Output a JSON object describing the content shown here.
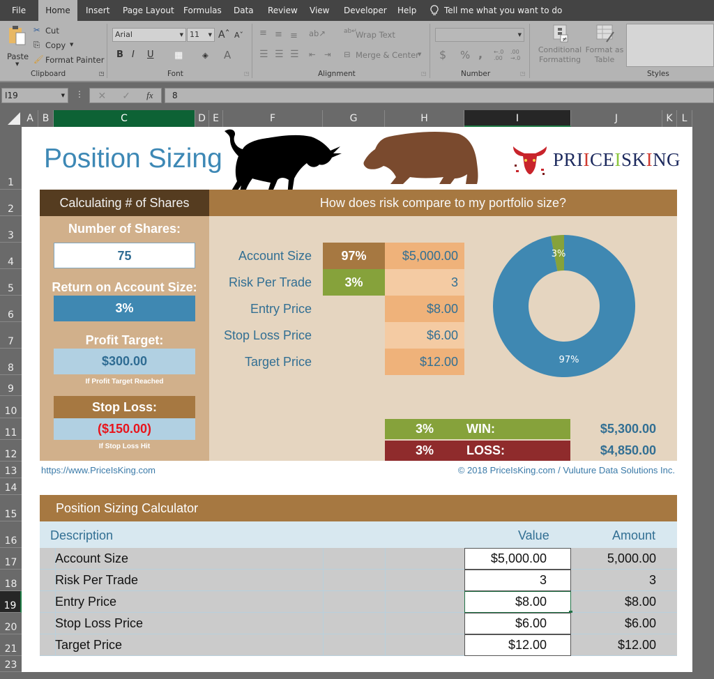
{
  "menu": {
    "tabs": [
      "File",
      "Home",
      "Insert",
      "Page Layout",
      "Formulas",
      "Data",
      "Review",
      "View",
      "Developer",
      "Help"
    ],
    "active_tab": "Home",
    "tell_me": "Tell me what you want to do"
  },
  "ribbon": {
    "clipboard": {
      "paste": "Paste",
      "cut": "Cut",
      "copy": "Copy",
      "format_painter": "Format Painter",
      "group_label": "Clipboard"
    },
    "font": {
      "font_name": "Arial",
      "font_size": "11",
      "group_label": "Font",
      "bold": "B",
      "italic": "I",
      "underline": "U"
    },
    "alignment": {
      "wrap_text": "Wrap Text",
      "merge_center": "Merge & Center",
      "group_label": "Alignment"
    },
    "number": {
      "format_value": "",
      "group_label": "Number",
      "currency": "$",
      "percent": "%",
      "comma": ",",
      "inc_decimal": "←.0 .00",
      "dec_decimal": ".00 →.0"
    },
    "styles": {
      "conditional_formatting": "Conditional Formatting",
      "format_as_table": "Format as Table",
      "group_label": "Styles"
    }
  },
  "formula_bar": {
    "name_box": "I19",
    "formula": "8",
    "fx": "fx"
  },
  "columns": [
    "A",
    "B",
    "C",
    "D",
    "E",
    "F",
    "G",
    "H",
    "I",
    "J",
    "K",
    "L"
  ],
  "rows": [
    "1",
    "2",
    "3",
    "4",
    "5",
    "6",
    "7",
    "8",
    "9",
    "10",
    "11",
    "12",
    "13",
    "14",
    "15",
    "16",
    "17",
    "18",
    "19",
    "20",
    "21",
    "23"
  ],
  "selected_cell": {
    "column": "I",
    "row": "19"
  },
  "sheet": {
    "title": "Position Sizing",
    "logo_text": {
      "part1": "PRI",
      "i1": "I",
      "part2": "CE",
      "i2": "I",
      "part3": "SK",
      "i3": "I",
      "part4": "NG"
    },
    "left_header": "Calculating # of Shares",
    "right_header": "How does risk compare to my portfolio size?",
    "number_of_shares_label": "Number of Shares:",
    "number_of_shares": "75",
    "return_label": "Return on Account Size:",
    "return_value": "3%",
    "profit_target_label": "Profit Target:",
    "profit_target_value": "$300.00",
    "profit_note": "If Profit Target Reached",
    "stop_loss_label": "Stop Loss:",
    "stop_loss_value": "($150.00)",
    "stop_loss_note": "If Stop Loss Hit",
    "inputs": [
      {
        "label": "Account Size",
        "pct": "97%",
        "value": "$5,000.00"
      },
      {
        "label": "Risk Per Trade",
        "pct": "3%",
        "value": "3"
      },
      {
        "label": "Entry Price",
        "pct": "",
        "value": "$8.00"
      },
      {
        "label": "Stop Loss Price",
        "pct": "",
        "value": "$6.00"
      },
      {
        "label": "Target Price",
        "pct": "",
        "value": "$12.00"
      }
    ],
    "win": {
      "pct": "3%",
      "label": "WIN:",
      "amount": "$5,300.00"
    },
    "loss": {
      "pct": "3%",
      "label": "LOSS:",
      "amount": "$4,850.00"
    },
    "link": "https://www.PriceIsKing.com",
    "copyright": "© 2018 PriceIsKing.com / Vuluture Data Solutions Inc."
  },
  "chart_data": {
    "type": "pie",
    "variant": "donut",
    "categories": [
      "Risk Per Trade",
      "Account Size"
    ],
    "values": [
      3,
      97
    ],
    "labels": [
      "3%",
      "97%"
    ],
    "colors": [
      "#86a23b",
      "#3f88b2"
    ],
    "title": ""
  },
  "calculator": {
    "title": "Position Sizing Calculator",
    "columns": [
      "Description",
      "Value",
      "Amount"
    ],
    "rows": [
      {
        "description": "Account Size",
        "value": "$5,000.00",
        "amount": "5,000.00"
      },
      {
        "description": "Risk Per Trade",
        "value": "3",
        "amount": "3"
      },
      {
        "description": "Entry Price",
        "value": "$8.00",
        "amount": "$8.00"
      },
      {
        "description": "Stop Loss Price",
        "value": "$6.00",
        "amount": "$6.00"
      },
      {
        "description": "Target Price",
        "value": "$12.00",
        "amount": "$12.00"
      }
    ]
  },
  "colors": {
    "brand_blue": "#3d88b5",
    "brown_dark": "#553c20",
    "brown": "#a67841",
    "tan": "#d1b08b",
    "beige": "#e5d5c0",
    "green": "#86a23b",
    "red": "#8f2b2c",
    "orange": "#efb27a",
    "orange_light": "#f4cba3",
    "loss_red": "#e8141b"
  }
}
